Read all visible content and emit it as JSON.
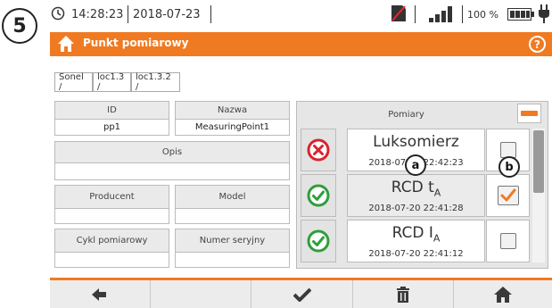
{
  "step_number": "5",
  "status_bar": {
    "time": "14:28:23",
    "date": "2018-07-23",
    "battery_percent": "100 %",
    "signal_level": 4
  },
  "title_bar": {
    "title": "Punkt pomiarowy"
  },
  "breadcrumb": [
    "Sonel /",
    "loc1.3 /",
    "loc1.3.2 /"
  ],
  "fields": {
    "id": {
      "label": "ID",
      "value": "pp1"
    },
    "name": {
      "label": "Nazwa",
      "value": "MeasuringPoint1"
    },
    "description": {
      "label": "Opis",
      "value": ""
    },
    "producer": {
      "label": "Producent",
      "value": ""
    },
    "model": {
      "label": "Model",
      "value": ""
    },
    "cycle": {
      "label": "Cykl pomiarowy",
      "value": ""
    },
    "serial": {
      "label": "Numer seryjny",
      "value": ""
    }
  },
  "measurements": {
    "header": "Pomiary",
    "rows": [
      {
        "name": "Luksomierz",
        "subscript": "",
        "date": "2018-07-23 22:42:23",
        "status": "fail",
        "checked": false
      },
      {
        "name": "RCD t",
        "subscript": "A",
        "date": "2018-07-20 22:41:28",
        "status": "pass",
        "checked": true
      },
      {
        "name": "RCD I",
        "subscript": "A",
        "date": "2018-07-20 22:41:12",
        "status": "pass",
        "checked": false
      }
    ]
  },
  "callouts": {
    "a": "a",
    "b": "b"
  },
  "colors": {
    "accent": "#f07a22",
    "pass": "#2f9e3b",
    "fail": "#d9232d"
  },
  "bottom_bar": {
    "icons": [
      "back-arrow-icon",
      "",
      "confirm-check-icon",
      "trash-icon",
      "home-icon"
    ]
  }
}
